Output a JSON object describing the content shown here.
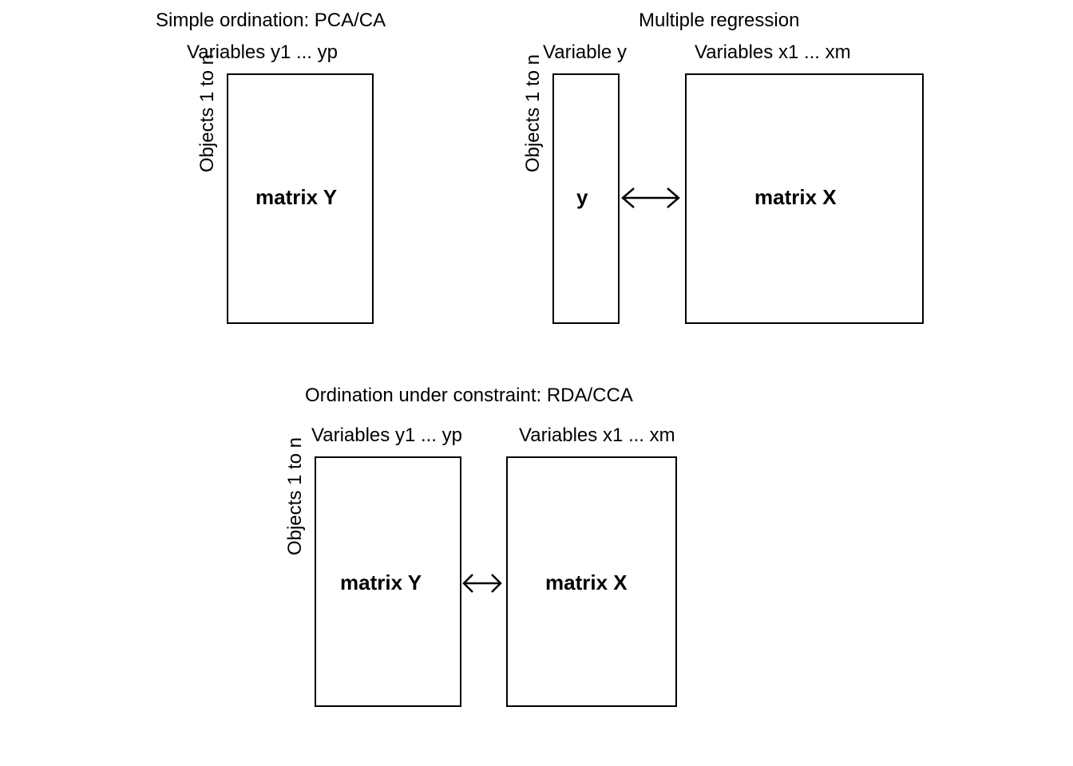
{
  "panel1": {
    "title": "Simple ordination: PCA/CA",
    "cols_label": "Variables y1 ... yp",
    "rows_label": "Objects 1 to n",
    "box_label": "matrix Y"
  },
  "panel2": {
    "title": "Multiple regression",
    "y_cols_label": "Variable y",
    "x_cols_label": "Variables x1 ... xm",
    "rows_label": "Objects 1 to n",
    "y_label": "y",
    "x_label": "matrix X"
  },
  "panel3": {
    "title": "Ordination under constraint: RDA/CCA",
    "y_cols_label": "Variables y1 ... yp",
    "x_cols_label": "Variables x1 ... xm",
    "rows_label": "Objects 1 to n",
    "y_label": "matrix Y",
    "x_label": "matrix X"
  }
}
